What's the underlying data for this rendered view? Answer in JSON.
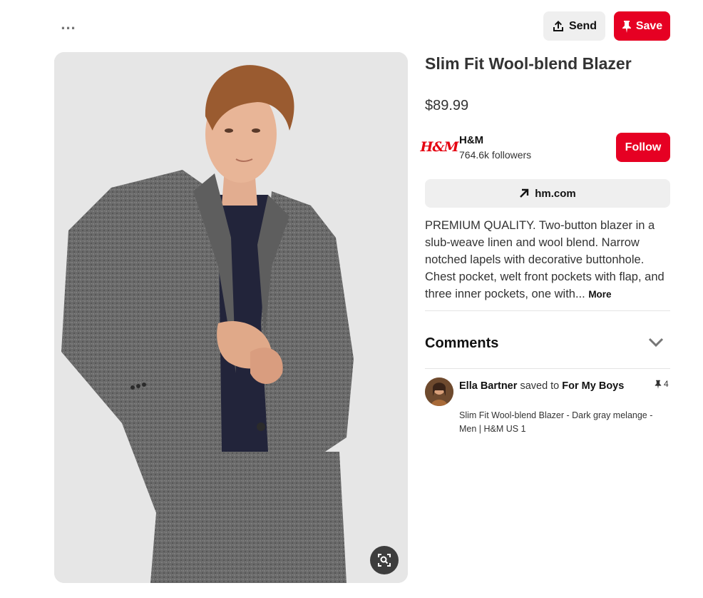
{
  "header": {
    "more_icon": "ellipsis-icon",
    "send_label": "Send",
    "save_label": "Save"
  },
  "pin": {
    "title": "Slim Fit Wool-blend Blazer",
    "price": "$89.99",
    "image_alt": "Man wearing a gray slim fit wool-blend blazer over a navy t-shirt",
    "lens_icon": "visual-search-icon"
  },
  "brand": {
    "logo_text": "H&M",
    "name": "H&M",
    "followers": "764.6k followers",
    "follow_label": "Follow"
  },
  "link": {
    "label": "hm.com"
  },
  "description": {
    "text": "PREMIUM QUALITY. Two-button blazer in a slub-weave linen and wool blend. Narrow notched lapels with decorative buttonhole. Chest pocket, welt front pockets with flap, and three inner pockets, one with...",
    "more_label": "More"
  },
  "comments": {
    "title": "Comments",
    "items": [
      {
        "user": "Ella Bartner",
        "action": "saved to",
        "board": "For My Boys",
        "subtitle": "Slim Fit Wool-blend Blazer - Dark gray melange - Men | H&M US 1",
        "pin_count": "4"
      }
    ]
  },
  "colors": {
    "accent": "#e60023",
    "brand_red": "#e50010",
    "button_gray": "#efefef"
  }
}
